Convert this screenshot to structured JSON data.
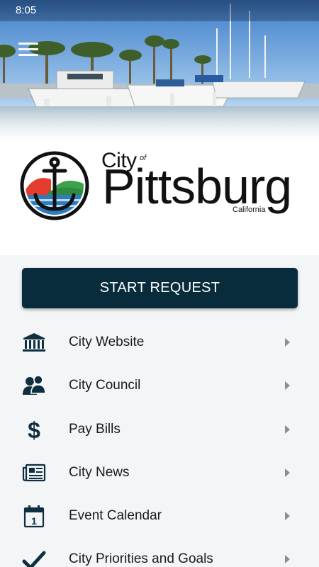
{
  "status_bar": {
    "time": "8:05"
  },
  "header": {
    "menu_icon": "hamburger-menu-icon"
  },
  "logo": {
    "city": "City",
    "of": "of",
    "name": "Pittsburg",
    "state": "California"
  },
  "start_request": {
    "label": "START REQUEST"
  },
  "menu": [
    {
      "label": "City Website",
      "icon": "city-hall-icon"
    },
    {
      "label": "City Council",
      "icon": "people-icon"
    },
    {
      "label": "Pay Bills",
      "icon": "dollar-icon"
    },
    {
      "label": "City News",
      "icon": "newspaper-icon"
    },
    {
      "label": "Event Calendar",
      "icon": "calendar-icon"
    },
    {
      "label": "City Priorities and Goals",
      "icon": "checkmark-icon"
    }
  ],
  "colors": {
    "primary": "#082c3c",
    "icon": "#0e2f40",
    "chevron": "#8a8f96",
    "background": "#f4f5f7"
  }
}
